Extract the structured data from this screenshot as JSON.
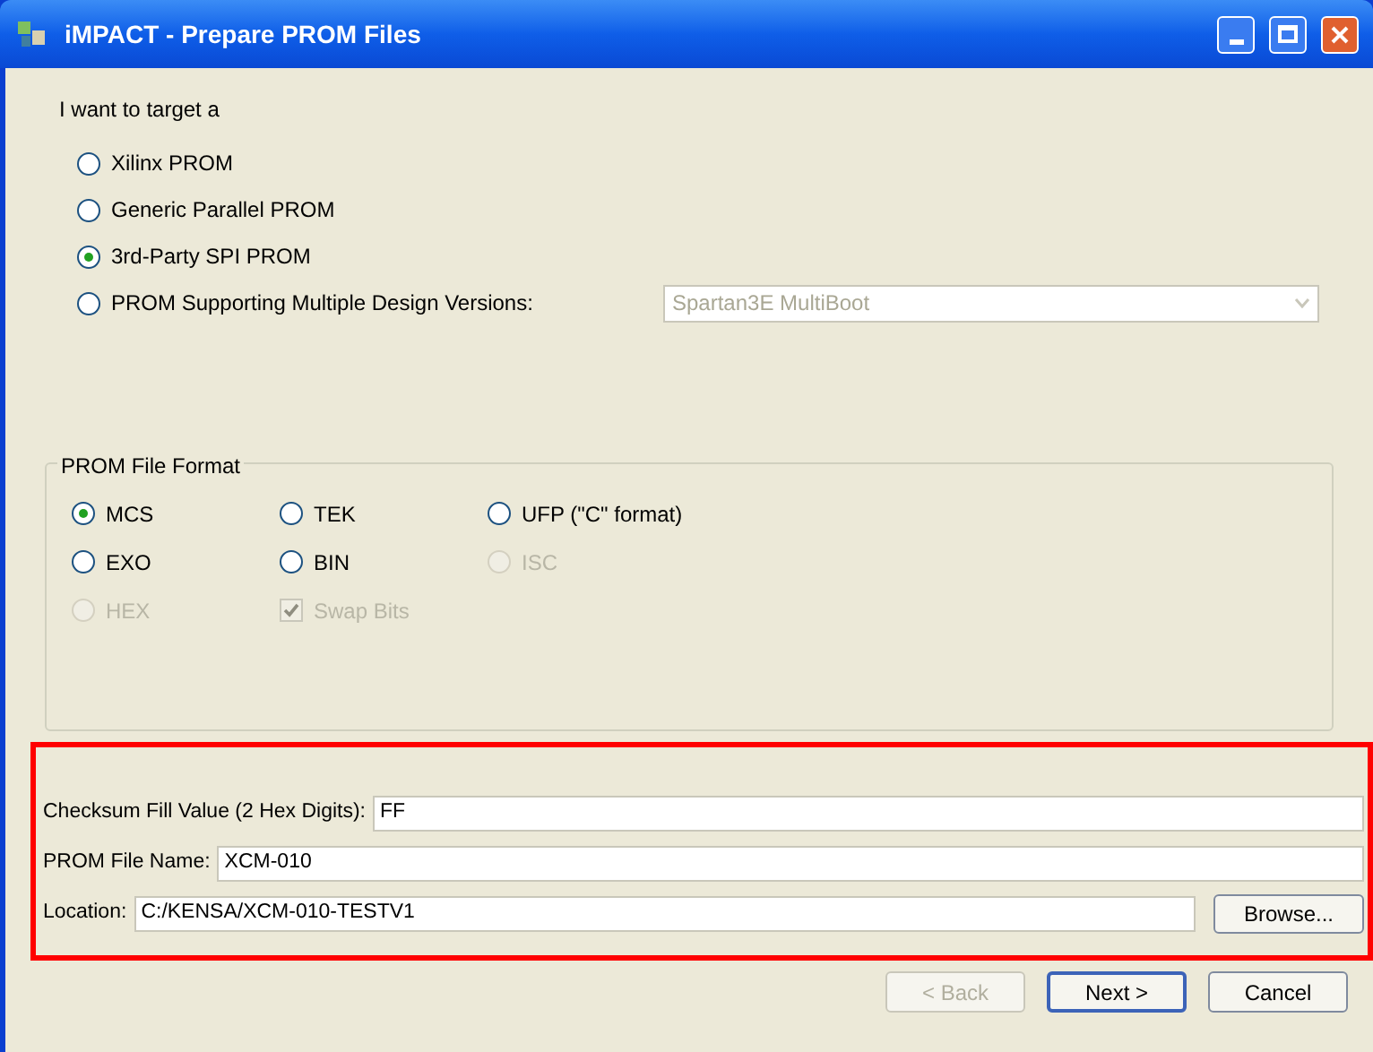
{
  "window": {
    "title": "iMPACT - Prepare PROM Files"
  },
  "target": {
    "label": "I want to target a",
    "options": [
      {
        "label": "Xilinx PROM",
        "selected": false
      },
      {
        "label": "Generic Parallel PROM",
        "selected": false
      },
      {
        "label": "3rd-Party SPI PROM",
        "selected": true
      },
      {
        "label": "PROM Supporting Multiple Design Versions:",
        "selected": false
      }
    ],
    "dropdown": {
      "value": "Spartan3E MultiBoot",
      "disabled": true
    }
  },
  "format": {
    "title": "PROM File Format",
    "rows": [
      [
        {
          "kind": "radio",
          "label": "MCS",
          "selected": true,
          "disabled": false
        },
        {
          "kind": "radio",
          "label": "TEK",
          "selected": false,
          "disabled": false
        },
        {
          "kind": "radio",
          "label": "UFP (\"C\" format)",
          "selected": false,
          "disabled": false
        }
      ],
      [
        {
          "kind": "radio",
          "label": "EXO",
          "selected": false,
          "disabled": false
        },
        {
          "kind": "radio",
          "label": "BIN",
          "selected": false,
          "disabled": false
        },
        {
          "kind": "radio",
          "label": "ISC",
          "selected": false,
          "disabled": true
        }
      ],
      [
        {
          "kind": "radio",
          "label": "HEX",
          "selected": false,
          "disabled": true
        },
        {
          "kind": "checkbox",
          "label": "Swap Bits",
          "checked": true,
          "disabled": true
        }
      ]
    ]
  },
  "fields": [
    {
      "label": "Checksum Fill Value (2 Hex Digits):",
      "value": "FF"
    },
    {
      "label": "PROM File Name:",
      "value": "XCM-010"
    },
    {
      "label": "Location:",
      "value": "C:/KENSA/XCM-010-TESTV1",
      "button": "Browse..."
    }
  ],
  "buttons": [
    {
      "label": "< Back",
      "disabled": true,
      "default": false
    },
    {
      "label": "Next >",
      "disabled": false,
      "default": true
    },
    {
      "label": "Cancel",
      "disabled": false,
      "default": false
    }
  ]
}
